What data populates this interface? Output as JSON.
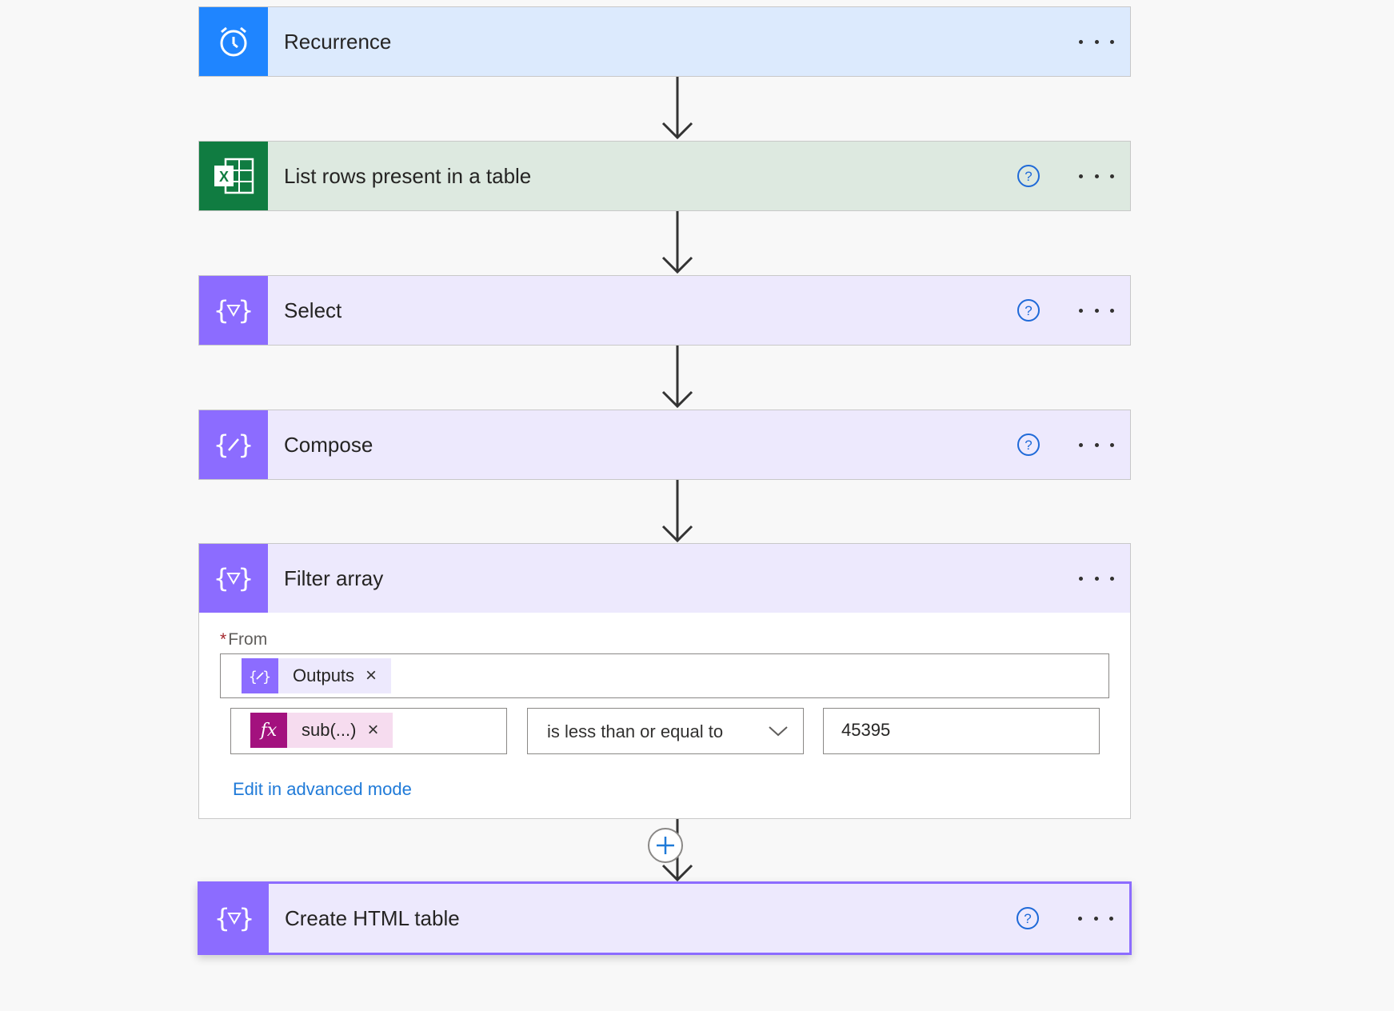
{
  "steps": [
    {
      "title": "Recurrence",
      "icon": "clock-icon",
      "color": "#1f85ff",
      "help": false
    },
    {
      "title": "List rows present in a table",
      "icon": "excel-icon",
      "color": "#107c41",
      "help": true
    },
    {
      "title": "Select",
      "icon": "data-operation-icon",
      "color": "#8c6cff",
      "help": true
    },
    {
      "title": "Compose",
      "icon": "compose-icon",
      "color": "#8c6cff",
      "help": true
    },
    {
      "title": "Filter array",
      "icon": "data-operation-icon",
      "color": "#8c6cff",
      "help": false
    },
    {
      "title": "Create HTML table",
      "icon": "data-operation-icon",
      "color": "#8c6cff",
      "help": true
    }
  ],
  "filter": {
    "from_label": "From",
    "from_token": "Outputs",
    "left_token": "sub(...)",
    "operator": "is less than or equal to",
    "value": "45395",
    "advanced_link": "Edit in advanced mode"
  }
}
